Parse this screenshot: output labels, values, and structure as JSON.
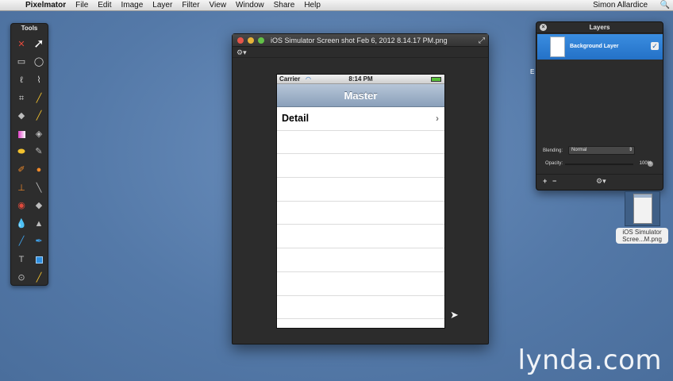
{
  "menubar": {
    "apple": "",
    "items": [
      "Pixelmator",
      "File",
      "Edit",
      "Image",
      "Layer",
      "Filter",
      "View",
      "Window",
      "Share",
      "Help"
    ],
    "user": "Simon Allardice",
    "spotlight": "🔍"
  },
  "tools_palette": {
    "title": "Tools"
  },
  "image_window": {
    "title": "iOS Simulator Screen shot Feb 6, 2012 8.14.17 PM.png",
    "fullscreen_icon": "⤢",
    "gear_icon": "⚙▾"
  },
  "ios_screen": {
    "carrier": "Carrier",
    "wifi": "◠",
    "time": "8:14 PM",
    "nav_title": "Master",
    "rows": [
      {
        "label": "Detail",
        "chevron": "›"
      },
      {
        "label": "",
        "chevron": ""
      },
      {
        "label": "",
        "chevron": ""
      },
      {
        "label": "",
        "chevron": ""
      },
      {
        "label": "",
        "chevron": ""
      },
      {
        "label": "",
        "chevron": ""
      },
      {
        "label": "",
        "chevron": ""
      },
      {
        "label": "",
        "chevron": ""
      },
      {
        "label": "",
        "chevron": ""
      },
      {
        "label": "",
        "chevron": ""
      }
    ]
  },
  "layers_panel": {
    "title": "Layers",
    "close": "×",
    "layer_name": "Background Layer",
    "layer_check": "✓",
    "blending_label": "Blending:",
    "blending_value": "Normal",
    "blending_arrow": "⇕",
    "opacity_label": "Opacity:",
    "opacity_value": "100%",
    "add": "+",
    "remove": "−",
    "gear": "⚙▾"
  },
  "desktop": {
    "file_name": "iOS Simulator Scree...M.png",
    "partial_label": "E"
  },
  "watermark": "lynda.com"
}
